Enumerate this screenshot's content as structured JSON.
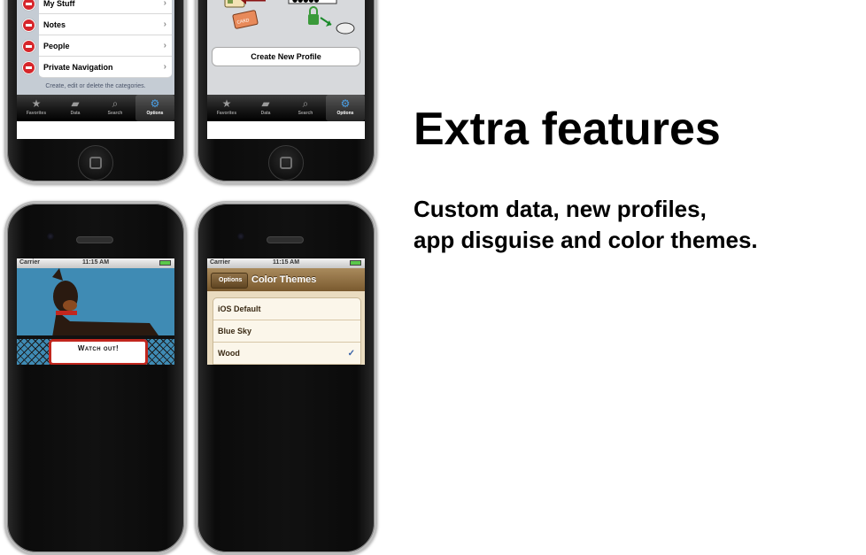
{
  "phone_1": {
    "categories": [
      {
        "label": "My Stuff"
      },
      {
        "label": "Notes"
      },
      {
        "label": "People"
      },
      {
        "label": "Private Navigation"
      }
    ],
    "footer_note": "Create, edit or delete the categories.",
    "tabs": [
      {
        "label": "Favorites",
        "icon": "star-icon"
      },
      {
        "label": "Data",
        "icon": "folder-icon"
      },
      {
        "label": "Search",
        "icon": "search-icon"
      },
      {
        "label": "Options",
        "icon": "gear-icon"
      }
    ],
    "active_tab": "Options"
  },
  "phone_2": {
    "password_mask": "●●●●●",
    "card_text": "CARD",
    "create_button": "Create New Profile",
    "tabs": [
      {
        "label": "Favorites",
        "icon": "star-icon"
      },
      {
        "label": "Data",
        "icon": "folder-icon"
      },
      {
        "label": "Search",
        "icon": "search-icon"
      },
      {
        "label": "Options",
        "icon": "gear-icon"
      }
    ]
  },
  "phone_3": {
    "status": {
      "carrier": "Carrier",
      "time": "11:15 AM"
    },
    "sign_text": "Watch out!"
  },
  "phone_4": {
    "status": {
      "carrier": "Carrier",
      "time": "11:15 AM"
    },
    "back_button": "Options",
    "title": "Color Themes",
    "themes": [
      {
        "label": "iOS Default",
        "selected": false
      },
      {
        "label": "Blue Sky",
        "selected": false
      },
      {
        "label": "Wood",
        "selected": true
      }
    ]
  },
  "marketing": {
    "headline": "Extra features",
    "subline_1": "Custom data, new profiles,",
    "subline_2": "app disguise and color themes."
  },
  "colors": {
    "accent_tab": "#4aa0e8",
    "delete_red": "#d6262b",
    "wood_nav": "#7a5a2f",
    "sign_border": "#c2271e",
    "sky": "#3f8bb4"
  }
}
